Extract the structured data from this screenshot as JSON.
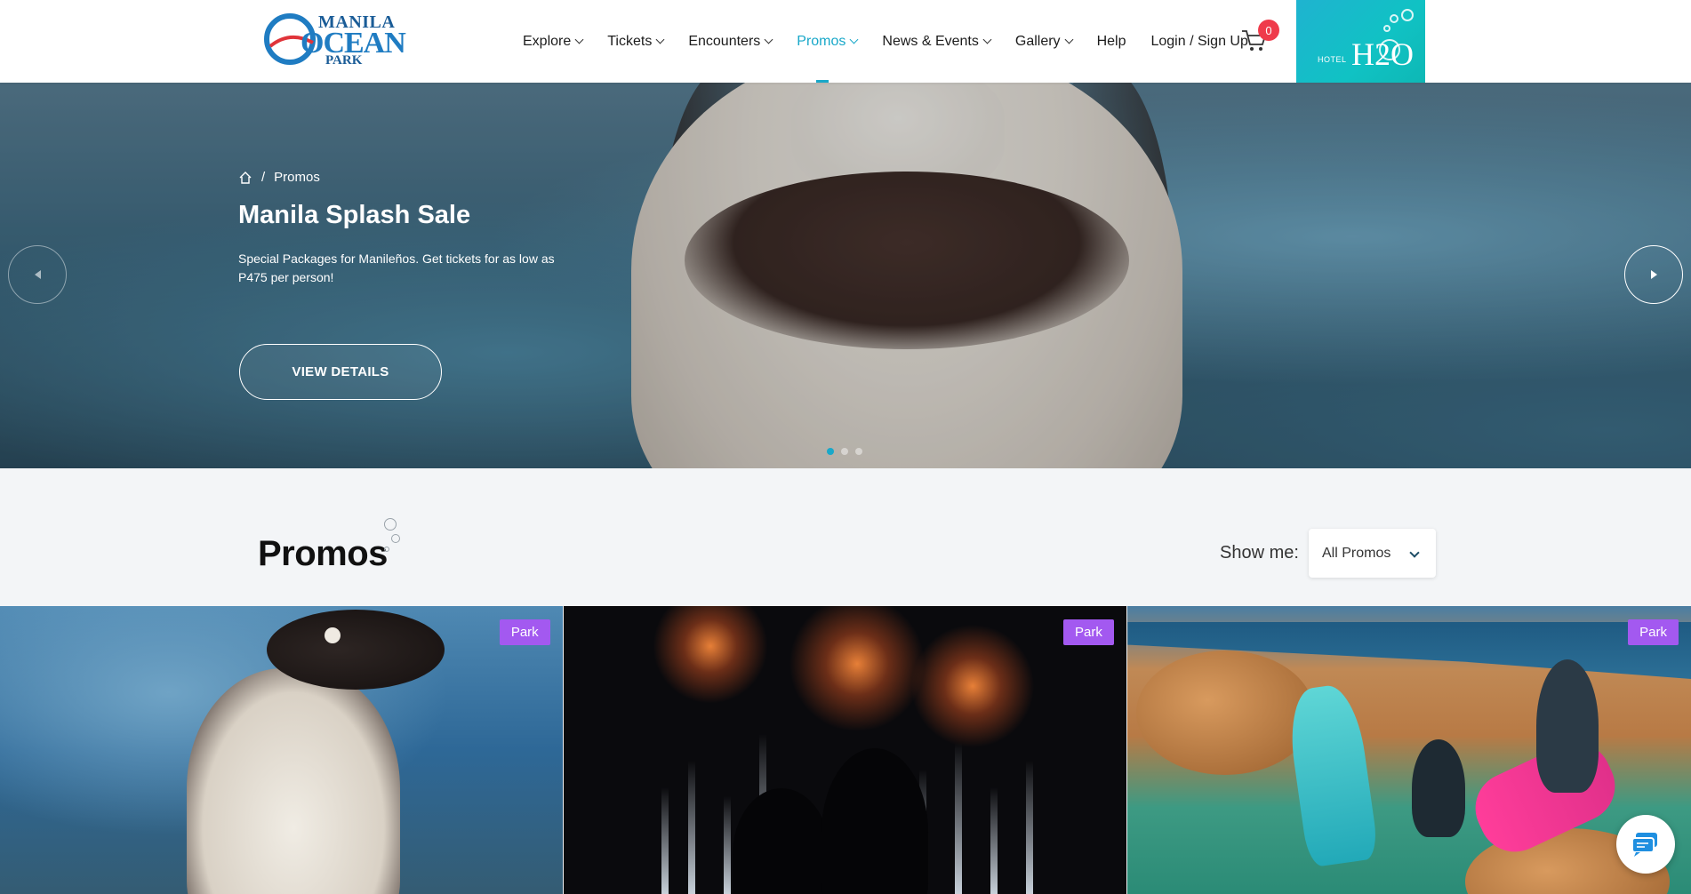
{
  "header": {
    "logo": {
      "line1": "MANILA",
      "line2": "OCEAN",
      "line3": "PARK"
    },
    "nav": [
      {
        "label": "Explore",
        "dropdown": true
      },
      {
        "label": "Tickets",
        "dropdown": true
      },
      {
        "label": "Encounters",
        "dropdown": true
      },
      {
        "label": "Promos",
        "dropdown": true,
        "active": true
      },
      {
        "label": "News & Events",
        "dropdown": true
      },
      {
        "label": "Gallery",
        "dropdown": true
      },
      {
        "label": "Help",
        "dropdown": false
      },
      {
        "label": "Login / Sign Up",
        "dropdown": false
      }
    ],
    "cart_count": "0",
    "hotel": {
      "word": "HOTEL",
      "brand": "H2O"
    }
  },
  "hero": {
    "breadcrumb_current": "Promos",
    "title": "Manila Splash Sale",
    "description": "Special Packages for Manileños. Get tickets for as low as P475 per person!",
    "button_label": "VIEW DETAILS",
    "slides_total": 3,
    "active_slide": 1
  },
  "promos": {
    "heading": "Promos",
    "filter_label": "Show me:",
    "filter_value": "All Promos"
  },
  "cards": [
    {
      "tag": "Park"
    },
    {
      "tag": "Park"
    },
    {
      "tag": "Park"
    }
  ],
  "colors": {
    "accent": "#19a8c9",
    "tag": "#a359f0",
    "badge": "#ef3b4b",
    "hotel": "#10c2c4"
  }
}
